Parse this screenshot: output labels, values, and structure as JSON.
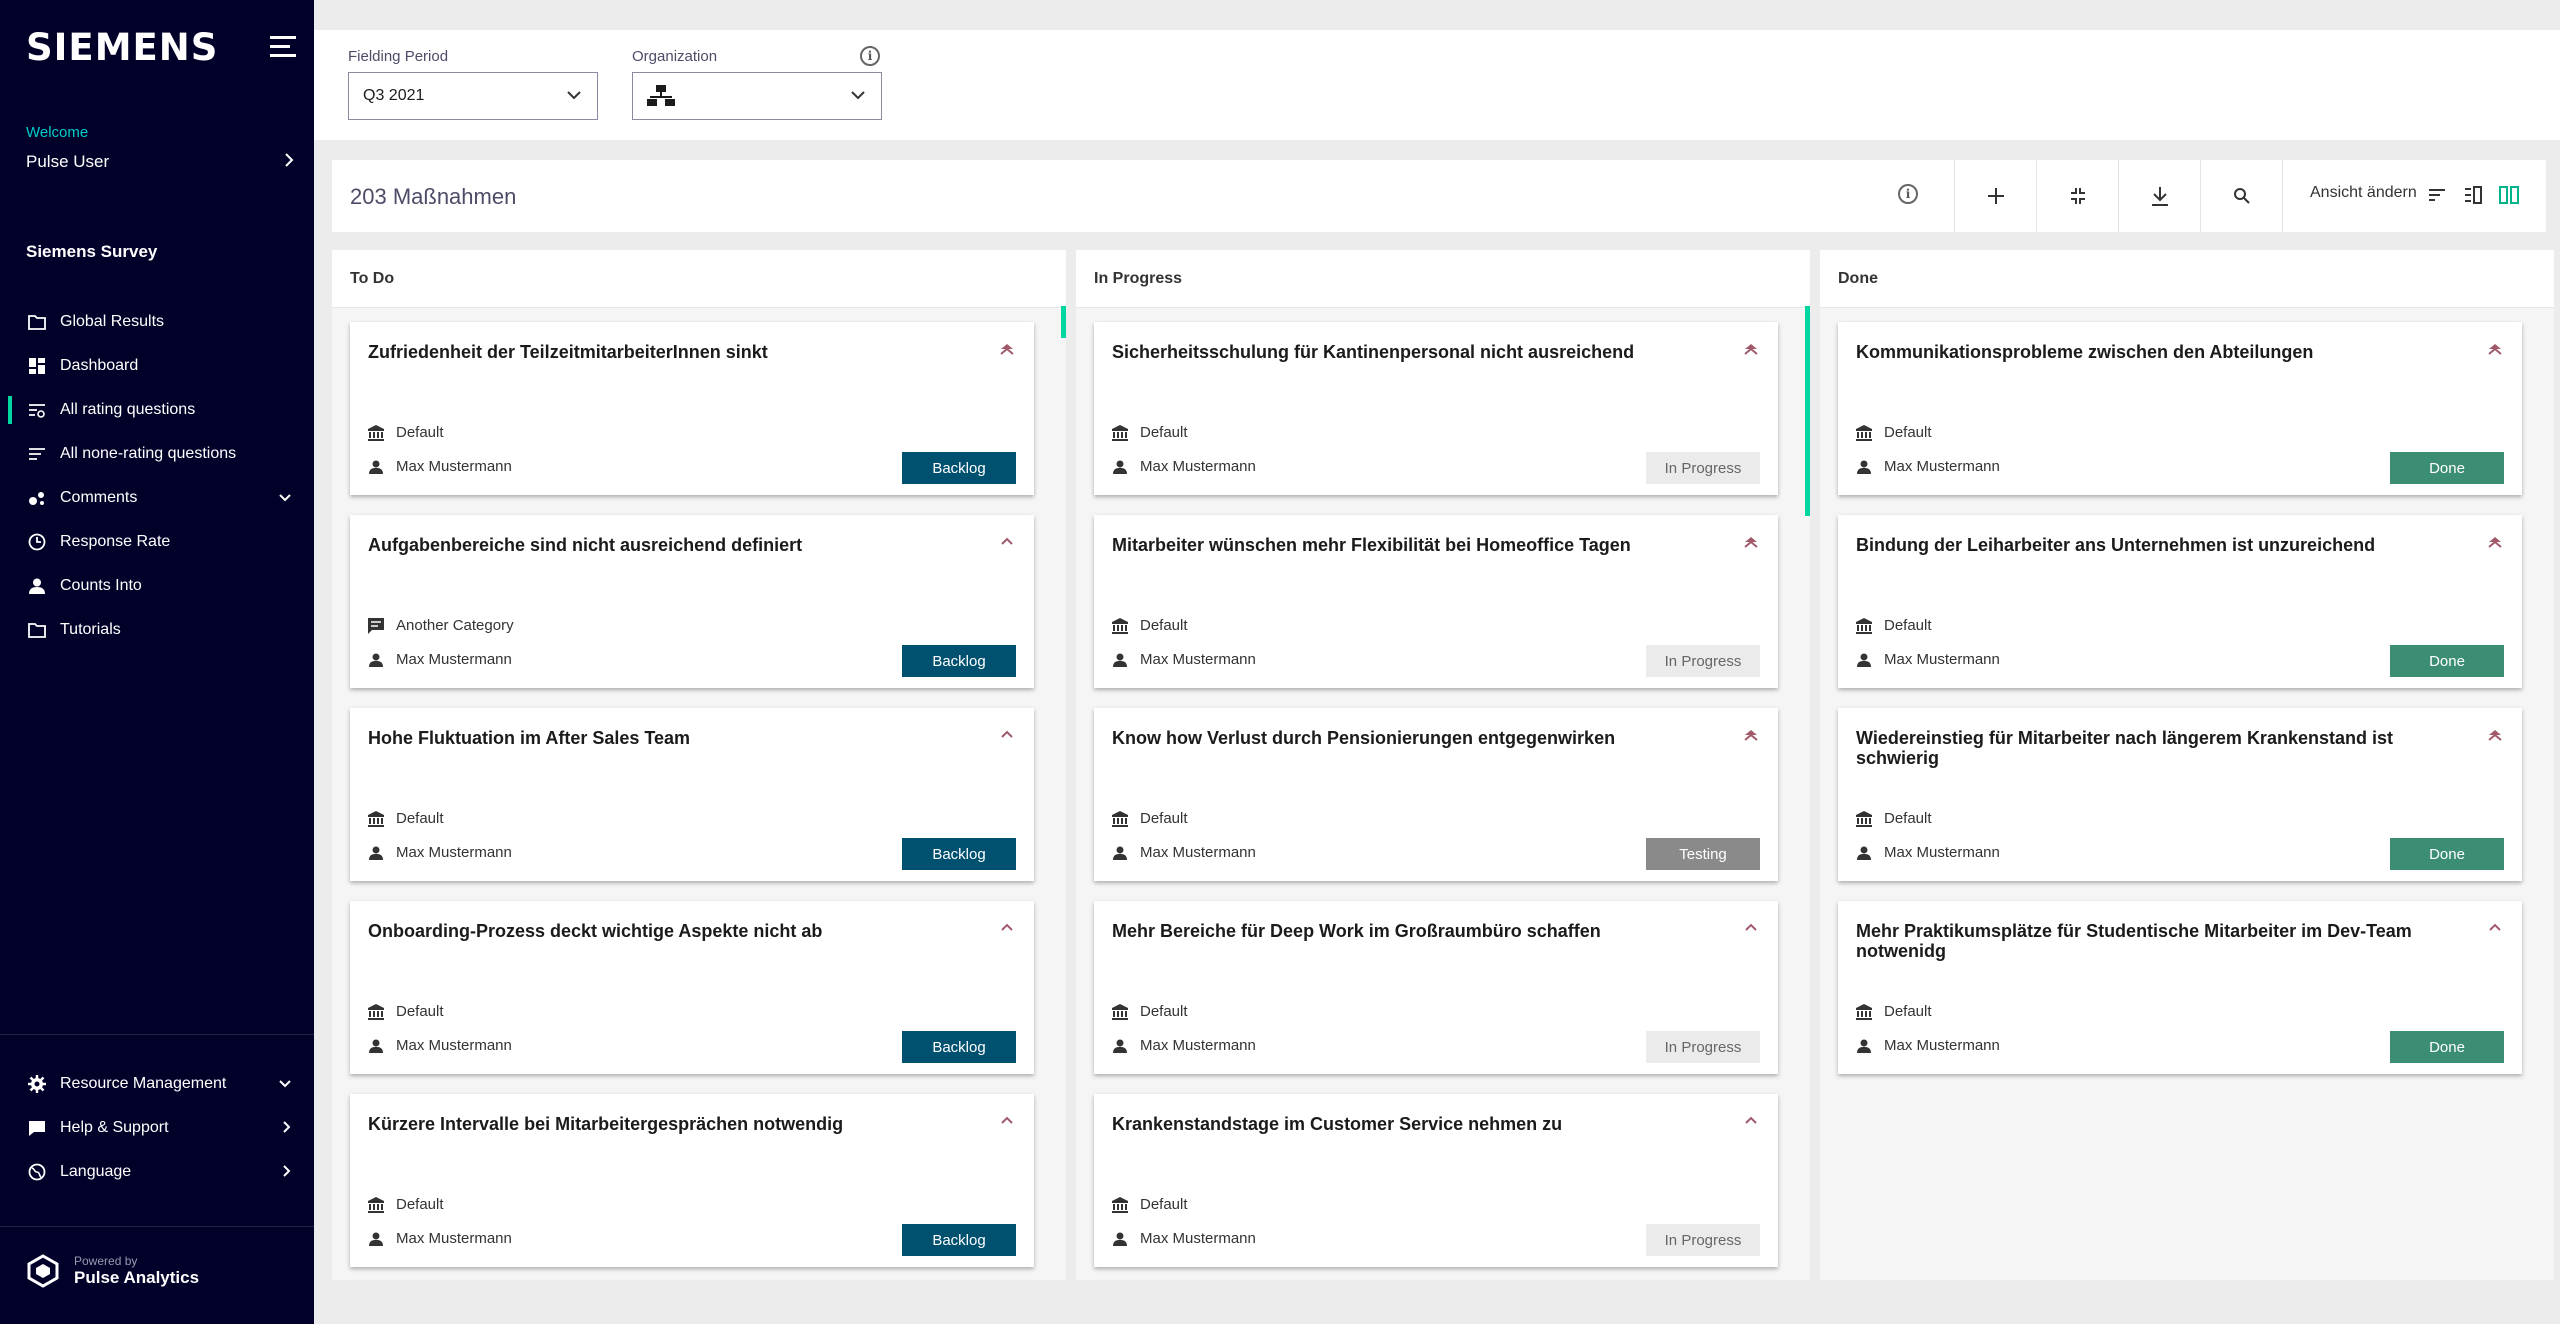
{
  "sidebar": {
    "logo": "SIEMENS",
    "welcome": "Welcome",
    "user": "Pulse User",
    "section_title": "Siemens Survey",
    "items": [
      {
        "label": "Global Results",
        "icon": "folder-icon",
        "active": false,
        "chevron": ""
      },
      {
        "label": "Dashboard",
        "icon": "dashboard-icon",
        "active": false,
        "chevron": ""
      },
      {
        "label": "All rating questions",
        "icon": "rating-list-icon",
        "active": true,
        "chevron": ""
      },
      {
        "label": "All none-rating questions",
        "icon": "list-icon",
        "active": false,
        "chevron": ""
      },
      {
        "label": "Comments",
        "icon": "comments-icon",
        "active": false,
        "chevron": "down"
      },
      {
        "label": "Response Rate",
        "icon": "clock-icon",
        "active": false,
        "chevron": ""
      },
      {
        "label": "Counts Into",
        "icon": "person-icon",
        "active": false,
        "chevron": ""
      },
      {
        "label": "Tutorials",
        "icon": "folder-icon",
        "active": false,
        "chevron": ""
      }
    ],
    "bottom_items": [
      {
        "label": "Resource Management",
        "icon": "gear-icon",
        "chevron": "down"
      },
      {
        "label": "Help & Support",
        "icon": "chat-icon",
        "chevron": "right"
      },
      {
        "label": "Language",
        "icon": "globe-icon",
        "chevron": "right"
      }
    ],
    "powered_by": "Powered by",
    "brand": "Pulse Analytics"
  },
  "filters": {
    "period_label": "Fielding Period",
    "period_value": "Q3 2021",
    "org_label": "Organization",
    "org_value": ""
  },
  "toolbar": {
    "title": "203 Maßnahmen",
    "view_label": "Ansicht ändern"
  },
  "columns": [
    {
      "title": "To Do",
      "cards": [
        {
          "title": "Zufriedenheit der TeilzeitmitarbeiterInnen sinkt",
          "category": "Default",
          "category_icon": "bank-icon",
          "owner": "Max Mustermann",
          "status": "Backlog",
          "priority": "highest"
        },
        {
          "title": "Aufgabenbereiche sind nicht ausreichend definiert",
          "category": "Another Category",
          "category_icon": "comment-icon",
          "owner": "Max Mustermann",
          "status": "Backlog",
          "priority": "high"
        },
        {
          "title": "Hohe Fluktuation im After Sales Team",
          "category": "Default",
          "category_icon": "bank-icon",
          "owner": "Max Mustermann",
          "status": "Backlog",
          "priority": "high"
        },
        {
          "title": "Onboarding-Prozess deckt wichtige Aspekte nicht ab",
          "category": "Default",
          "category_icon": "bank-icon",
          "owner": "Max Mustermann",
          "status": "Backlog",
          "priority": "high"
        },
        {
          "title": "Kürzere Intervalle bei Mitarbeitergesprächen notwendig",
          "category": "Default",
          "category_icon": "bank-icon",
          "owner": "Max Mustermann",
          "status": "Backlog",
          "priority": "high"
        }
      ]
    },
    {
      "title": "In Progress",
      "cards": [
        {
          "title": "Sicherheitsschulung für Kantinenpersonal nicht ausreichend",
          "category": "Default",
          "category_icon": "bank-icon",
          "owner": "Max Mustermann",
          "status": "In Progress",
          "priority": "highest"
        },
        {
          "title": "Mitarbeiter wünschen mehr Flexibilität bei Homeoffice Tagen",
          "category": "Default",
          "category_icon": "bank-icon",
          "owner": "Max Mustermann",
          "status": "In Progress",
          "priority": "highest"
        },
        {
          "title": "Know how Verlust durch Pensionierungen entgegenwirken",
          "category": "Default",
          "category_icon": "bank-icon",
          "owner": "Max Mustermann",
          "status": "Testing",
          "priority": "highest"
        },
        {
          "title": "Mehr Bereiche für Deep Work im Großraumbüro schaffen",
          "category": "Default",
          "category_icon": "bank-icon",
          "owner": "Max Mustermann",
          "status": "In Progress",
          "priority": "high"
        },
        {
          "title": "Krankenstandstage im Customer Service nehmen zu",
          "category": "Default",
          "category_icon": "bank-icon",
          "owner": "Max Mustermann",
          "status": "In Progress",
          "priority": "high"
        }
      ]
    },
    {
      "title": "Done",
      "cards": [
        {
          "title": "Kommunikationsprobleme zwischen den Abteilungen",
          "category": "Default",
          "category_icon": "bank-icon",
          "owner": "Max Mustermann",
          "status": "Done",
          "priority": "highest"
        },
        {
          "title": "Bindung der Leiharbeiter ans Unternehmen ist unzureichend",
          "category": "Default",
          "category_icon": "bank-icon",
          "owner": "Max Mustermann",
          "status": "Done",
          "priority": "highest"
        },
        {
          "title": "Wiedereinstieg für Mitarbeiter nach längerem Krankenstand ist schwierig",
          "category": "Default",
          "category_icon": "bank-icon",
          "owner": "Max Mustermann",
          "status": "Done",
          "priority": "highest"
        },
        {
          "title": "Mehr Praktikumsplätze für Studentische Mitarbeiter im Dev-Team notwenidg",
          "category": "Default",
          "category_icon": "bank-icon",
          "owner": "Max Mustermann",
          "status": "Done",
          "priority": "high"
        }
      ]
    }
  ],
  "colors": {
    "sidebar_bg": "#000028",
    "accent": "#00d7a0",
    "backlog": "#005070",
    "done": "#3b8d73",
    "testing": "#8a8a8a",
    "priority": "#a05a6a"
  }
}
